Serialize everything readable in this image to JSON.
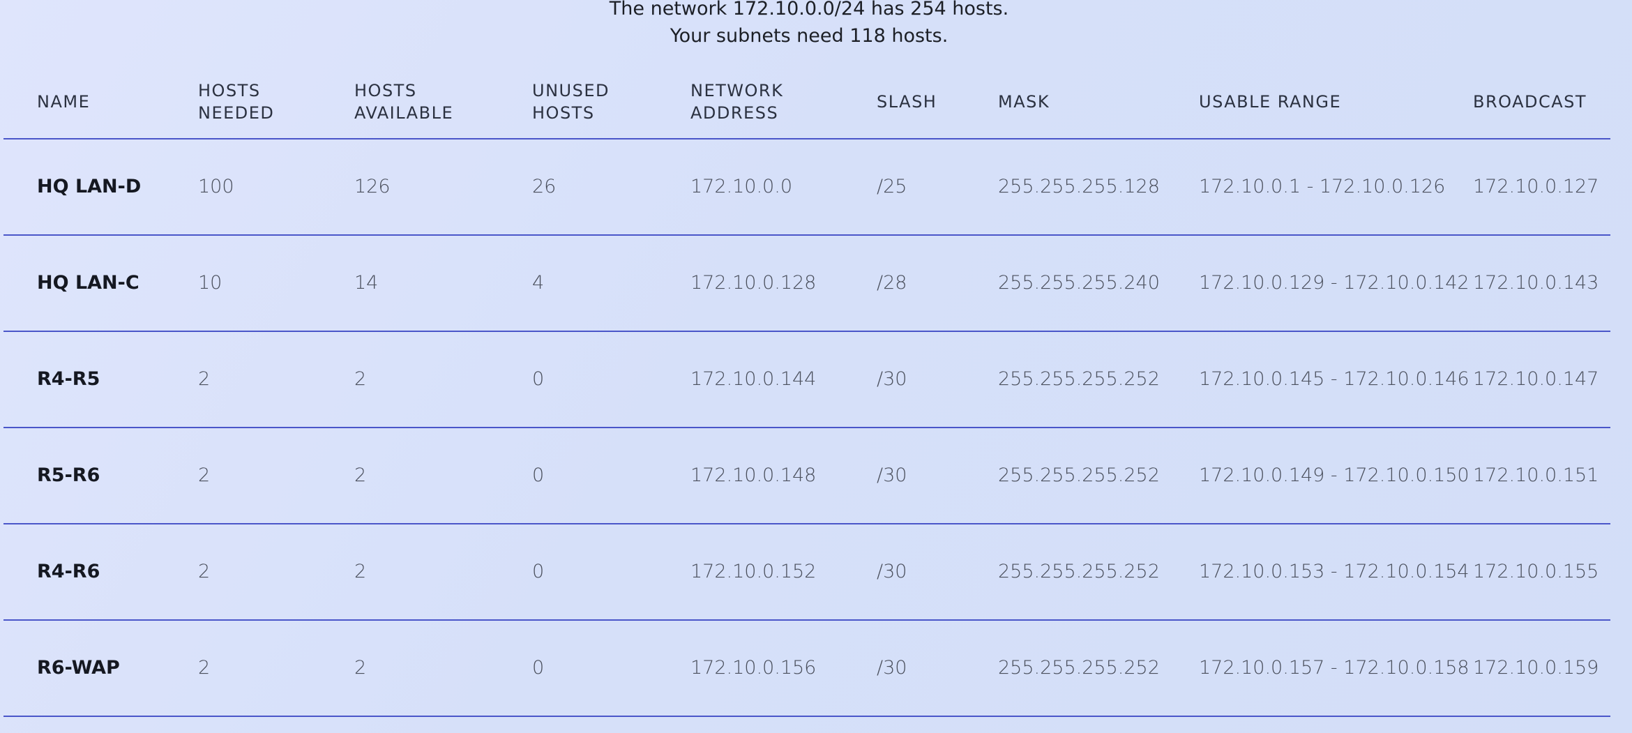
{
  "summary": {
    "line1": "The network 172.10.0.0/24 has 254 hosts.",
    "line2": "Your subnets need 118 hosts."
  },
  "columns": {
    "name": "NAME",
    "hosts_needed_1": "HOSTS",
    "hosts_needed_2": "NEEDED",
    "hosts_available_1": "HOSTS",
    "hosts_available_2": "AVAILABLE",
    "unused_hosts_1": "UNUSED",
    "unused_hosts_2": "HOSTS",
    "network_address_1": "NETWORK",
    "network_address_2": "ADDRESS",
    "slash": "SLASH",
    "mask": "MASK",
    "usable_range": "USABLE RANGE",
    "broadcast": "BROADCAST"
  },
  "rows": [
    {
      "name": "HQ LAN-D",
      "needed": "100",
      "available": "126",
      "unused": "26",
      "network": "172.10.0.0",
      "slash": "/25",
      "mask": "255.255.255.128",
      "range": "172.10.0.1 - 172.10.0.126",
      "broadcast": "172.10.0.127"
    },
    {
      "name": "HQ LAN-C",
      "needed": "10",
      "available": "14",
      "unused": "4",
      "network": "172.10.0.128",
      "slash": "/28",
      "mask": "255.255.255.240",
      "range": "172.10.0.129 - 172.10.0.142",
      "broadcast": "172.10.0.143"
    },
    {
      "name": "R4-R5",
      "needed": "2",
      "available": "2",
      "unused": "0",
      "network": "172.10.0.144",
      "slash": "/30",
      "mask": "255.255.255.252",
      "range": "172.10.0.145 - 172.10.0.146",
      "broadcast": "172.10.0.147"
    },
    {
      "name": "R5-R6",
      "needed": "2",
      "available": "2",
      "unused": "0",
      "network": "172.10.0.148",
      "slash": "/30",
      "mask": "255.255.255.252",
      "range": "172.10.0.149 - 172.10.0.150",
      "broadcast": "172.10.0.151"
    },
    {
      "name": "R4-R6",
      "needed": "2",
      "available": "2",
      "unused": "0",
      "network": "172.10.0.152",
      "slash": "/30",
      "mask": "255.255.255.252",
      "range": "172.10.0.153 - 172.10.0.154",
      "broadcast": "172.10.0.155"
    },
    {
      "name": "R6-WAP",
      "needed": "2",
      "available": "2",
      "unused": "0",
      "network": "172.10.0.156",
      "slash": "/30",
      "mask": "255.255.255.252",
      "range": "172.10.0.157 - 172.10.0.158",
      "broadcast": "172.10.0.159"
    }
  ]
}
